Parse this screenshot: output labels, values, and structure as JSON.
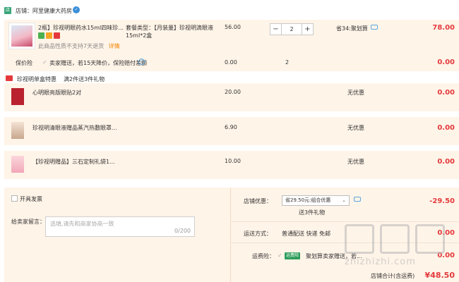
{
  "shop": {
    "label": "店铺：阿里健康大药房",
    "icon": "店",
    "badge": "✓"
  },
  "main_item": {
    "title": "2瓶】珍视明眼药水15ml四味珍...",
    "spec": "套餐类型：【月装量】珍视明滴眼液15ml*2盒",
    "price": "56.00",
    "quantity": "2",
    "promo": "省34:聚划算",
    "total": "78.00",
    "notice": "此商品性质不支持7天退货",
    "notice_link": "详情"
  },
  "insurance": {
    "label": "保价险",
    "desc": "卖家赠送，若15天降价，保险赔付差额",
    "price": "0.00",
    "qty": "2",
    "total": "0.00"
  },
  "gift_header": {
    "name": "珍视明单盒特惠",
    "rule": "满2件送3件礼物"
  },
  "gifts": [
    {
      "title": "心明眼亮版眼贴2对",
      "price": "20.00",
      "discount": "无优惠",
      "total": "0.00"
    },
    {
      "title": "珍视明清眼液赠品蒸汽热敷眼罩...",
      "price": "6.90",
      "discount": "无优惠",
      "total": "0.00"
    },
    {
      "title": "【珍视明赠品】三石定制礼袋1...",
      "price": "10.00",
      "discount": "无优惠",
      "total": "0.00"
    }
  ],
  "invoice": {
    "label": "开具发票"
  },
  "message": {
    "label": "给卖家留言：",
    "placeholder": "选填,请先和商家协商一致",
    "counter": "0/200"
  },
  "shop_discount": {
    "label": "店铺优惠：",
    "value": "省29.50元:组合优惠",
    "sub": "送3件礼物",
    "amount": "-29.50"
  },
  "shipping": {
    "label": "运送方式：",
    "value": "普通配送 快递 免邮",
    "amount": "0.00"
  },
  "freight_insurance": {
    "label": "运费险：",
    "tag": "运费险",
    "desc": "聚划算卖家赠送，若...",
    "amount": "0.00"
  },
  "footer": {
    "total_label": "店铺合计(含运费)",
    "total": "¥48.50"
  },
  "watermark": {
    "text": "zhizhizhi.com"
  },
  "colors": {
    "accent_red": "#e4393c",
    "row_bg": "#fff4e8",
    "link_blue": "#1e5a9b"
  }
}
